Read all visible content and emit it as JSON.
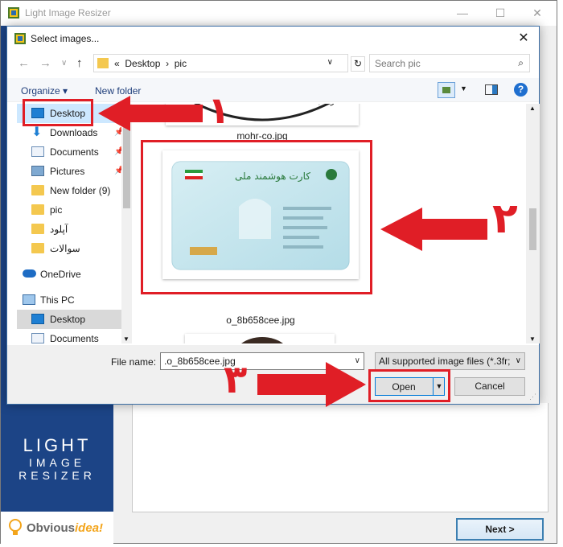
{
  "app": {
    "title": "Light Image Resizer",
    "brand_line1": "LIGHT",
    "brand_line2": "IMAGE",
    "brand_line3": "RESIZER",
    "vendor_prefix": "Obvious",
    "vendor_suffix": "idea!",
    "next_label": "Next >"
  },
  "dialog": {
    "title": "Select images...",
    "path_prefix": "«",
    "path_1": "Desktop",
    "path_sep": "›",
    "path_2": "pic",
    "search_placeholder": "Search pic",
    "organize_label": "Organize ▾",
    "new_folder_label": "New folder",
    "file_name_label": "File name:",
    "file_name_value": ".o_8b658cee.jpg",
    "filter_value": "All supported image files (*.3fr;",
    "open_label": "Open",
    "cancel_label": "Cancel"
  },
  "tree": [
    {
      "label": "Desktop",
      "icon": "desktop-icon",
      "pinned": false
    },
    {
      "label": "Downloads",
      "icon": "download-icon",
      "pinned": true
    },
    {
      "label": "Documents",
      "icon": "documents-icon",
      "pinned": true
    },
    {
      "label": "Pictures",
      "icon": "pictures-icon",
      "pinned": true
    },
    {
      "label": "New folder (9)",
      "icon": "folder-icon",
      "pinned": false
    },
    {
      "label": "pic",
      "icon": "folder-icon",
      "pinned": false
    },
    {
      "label": "آپلود",
      "icon": "folder-icon",
      "pinned": false
    },
    {
      "label": "سوالات",
      "icon": "folder-icon",
      "pinned": false
    },
    {
      "label": "OneDrive",
      "icon": "onedrive-icon",
      "pinned": false
    },
    {
      "label": "This PC",
      "icon": "pc-icon",
      "pinned": false
    },
    {
      "label": "Desktop",
      "icon": "desktop-icon",
      "pinned": false
    },
    {
      "label": "Documents",
      "icon": "documents-icon",
      "pinned": false
    }
  ],
  "files": [
    {
      "name": "mohr-co.jpg"
    },
    {
      "name": "o_8b658cee.jpg"
    }
  ],
  "annotations": {
    "num1": "۱",
    "num2": "۲",
    "num3": "۳"
  }
}
